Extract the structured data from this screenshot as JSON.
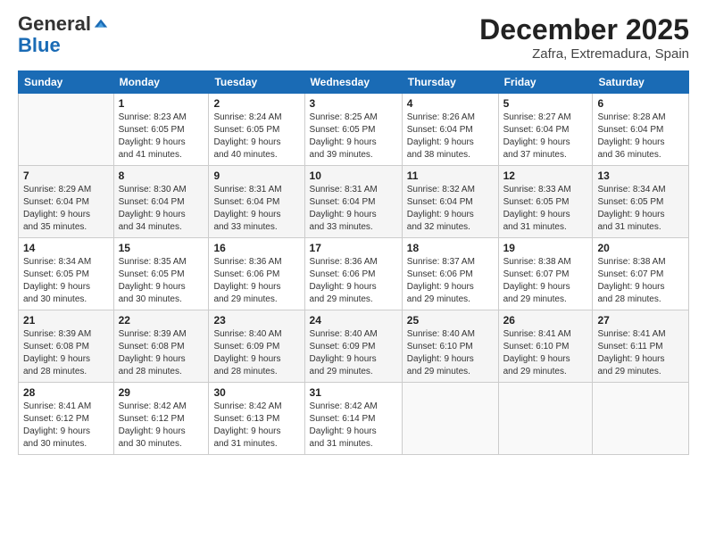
{
  "header": {
    "logo_line1": "General",
    "logo_line2": "Blue",
    "month": "December 2025",
    "location": "Zafra, Extremadura, Spain"
  },
  "days_of_week": [
    "Sunday",
    "Monday",
    "Tuesday",
    "Wednesday",
    "Thursday",
    "Friday",
    "Saturday"
  ],
  "weeks": [
    [
      {
        "day": "",
        "info": ""
      },
      {
        "day": "1",
        "info": "Sunrise: 8:23 AM\nSunset: 6:05 PM\nDaylight: 9 hours\nand 41 minutes."
      },
      {
        "day": "2",
        "info": "Sunrise: 8:24 AM\nSunset: 6:05 PM\nDaylight: 9 hours\nand 40 minutes."
      },
      {
        "day": "3",
        "info": "Sunrise: 8:25 AM\nSunset: 6:05 PM\nDaylight: 9 hours\nand 39 minutes."
      },
      {
        "day": "4",
        "info": "Sunrise: 8:26 AM\nSunset: 6:04 PM\nDaylight: 9 hours\nand 38 minutes."
      },
      {
        "day": "5",
        "info": "Sunrise: 8:27 AM\nSunset: 6:04 PM\nDaylight: 9 hours\nand 37 minutes."
      },
      {
        "day": "6",
        "info": "Sunrise: 8:28 AM\nSunset: 6:04 PM\nDaylight: 9 hours\nand 36 minutes."
      }
    ],
    [
      {
        "day": "7",
        "info": "Sunrise: 8:29 AM\nSunset: 6:04 PM\nDaylight: 9 hours\nand 35 minutes."
      },
      {
        "day": "8",
        "info": "Sunrise: 8:30 AM\nSunset: 6:04 PM\nDaylight: 9 hours\nand 34 minutes."
      },
      {
        "day": "9",
        "info": "Sunrise: 8:31 AM\nSunset: 6:04 PM\nDaylight: 9 hours\nand 33 minutes."
      },
      {
        "day": "10",
        "info": "Sunrise: 8:31 AM\nSunset: 6:04 PM\nDaylight: 9 hours\nand 33 minutes."
      },
      {
        "day": "11",
        "info": "Sunrise: 8:32 AM\nSunset: 6:04 PM\nDaylight: 9 hours\nand 32 minutes."
      },
      {
        "day": "12",
        "info": "Sunrise: 8:33 AM\nSunset: 6:05 PM\nDaylight: 9 hours\nand 31 minutes."
      },
      {
        "day": "13",
        "info": "Sunrise: 8:34 AM\nSunset: 6:05 PM\nDaylight: 9 hours\nand 31 minutes."
      }
    ],
    [
      {
        "day": "14",
        "info": "Sunrise: 8:34 AM\nSunset: 6:05 PM\nDaylight: 9 hours\nand 30 minutes."
      },
      {
        "day": "15",
        "info": "Sunrise: 8:35 AM\nSunset: 6:05 PM\nDaylight: 9 hours\nand 30 minutes."
      },
      {
        "day": "16",
        "info": "Sunrise: 8:36 AM\nSunset: 6:06 PM\nDaylight: 9 hours\nand 29 minutes."
      },
      {
        "day": "17",
        "info": "Sunrise: 8:36 AM\nSunset: 6:06 PM\nDaylight: 9 hours\nand 29 minutes."
      },
      {
        "day": "18",
        "info": "Sunrise: 8:37 AM\nSunset: 6:06 PM\nDaylight: 9 hours\nand 29 minutes."
      },
      {
        "day": "19",
        "info": "Sunrise: 8:38 AM\nSunset: 6:07 PM\nDaylight: 9 hours\nand 29 minutes."
      },
      {
        "day": "20",
        "info": "Sunrise: 8:38 AM\nSunset: 6:07 PM\nDaylight: 9 hours\nand 28 minutes."
      }
    ],
    [
      {
        "day": "21",
        "info": "Sunrise: 8:39 AM\nSunset: 6:08 PM\nDaylight: 9 hours\nand 28 minutes."
      },
      {
        "day": "22",
        "info": "Sunrise: 8:39 AM\nSunset: 6:08 PM\nDaylight: 9 hours\nand 28 minutes."
      },
      {
        "day": "23",
        "info": "Sunrise: 8:40 AM\nSunset: 6:09 PM\nDaylight: 9 hours\nand 28 minutes."
      },
      {
        "day": "24",
        "info": "Sunrise: 8:40 AM\nSunset: 6:09 PM\nDaylight: 9 hours\nand 29 minutes."
      },
      {
        "day": "25",
        "info": "Sunrise: 8:40 AM\nSunset: 6:10 PM\nDaylight: 9 hours\nand 29 minutes."
      },
      {
        "day": "26",
        "info": "Sunrise: 8:41 AM\nSunset: 6:10 PM\nDaylight: 9 hours\nand 29 minutes."
      },
      {
        "day": "27",
        "info": "Sunrise: 8:41 AM\nSunset: 6:11 PM\nDaylight: 9 hours\nand 29 minutes."
      }
    ],
    [
      {
        "day": "28",
        "info": "Sunrise: 8:41 AM\nSunset: 6:12 PM\nDaylight: 9 hours\nand 30 minutes."
      },
      {
        "day": "29",
        "info": "Sunrise: 8:42 AM\nSunset: 6:12 PM\nDaylight: 9 hours\nand 30 minutes."
      },
      {
        "day": "30",
        "info": "Sunrise: 8:42 AM\nSunset: 6:13 PM\nDaylight: 9 hours\nand 31 minutes."
      },
      {
        "day": "31",
        "info": "Sunrise: 8:42 AM\nSunset: 6:14 PM\nDaylight: 9 hours\nand 31 minutes."
      },
      {
        "day": "",
        "info": ""
      },
      {
        "day": "",
        "info": ""
      },
      {
        "day": "",
        "info": ""
      }
    ]
  ]
}
